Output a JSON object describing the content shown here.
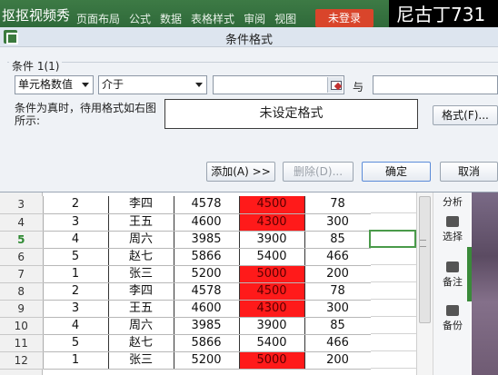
{
  "topbar": {
    "watermark_left": "抠抠视频秀",
    "ribbon_tabs": [
      "页面布局",
      "公式",
      "数据",
      "表格样式",
      "审阅",
      "视图"
    ],
    "login_label": "未登录",
    "watermark_right": "尼古丁731"
  },
  "dialog": {
    "title": "条件格式",
    "group_label": "条件 1(1)",
    "condition_type": "单元格数值",
    "operator": "介于",
    "value1": "",
    "and_label": "与",
    "value2": "",
    "hint": "条件为真时，待用格式如右图所示:",
    "preview_text": "未设定格式",
    "format_button": "格式(F)...",
    "add_button": "添加(A) >>",
    "delete_button": "删除(D)...",
    "ok_button": "确定",
    "cancel_button": "取消"
  },
  "sheet": {
    "active_row": "5",
    "rows": [
      {
        "row": "3",
        "a": "2",
        "b": "李四",
        "c": "4578",
        "d": "4500",
        "e": "78",
        "highlight": true
      },
      {
        "row": "4",
        "a": "3",
        "b": "王五",
        "c": "4600",
        "d": "4300",
        "e": "300",
        "highlight": true
      },
      {
        "row": "5",
        "a": "4",
        "b": "周六",
        "c": "3985",
        "d": "3900",
        "e": "85",
        "highlight": false
      },
      {
        "row": "6",
        "a": "5",
        "b": "赵七",
        "c": "5866",
        "d": "5400",
        "e": "466",
        "highlight": false
      },
      {
        "row": "7",
        "a": "1",
        "b": "张三",
        "c": "5200",
        "d": "5000",
        "e": "200",
        "highlight": true
      },
      {
        "row": "8",
        "a": "2",
        "b": "李四",
        "c": "4578",
        "d": "4500",
        "e": "78",
        "highlight": true
      },
      {
        "row": "9",
        "a": "3",
        "b": "王五",
        "c": "4600",
        "d": "4300",
        "e": "300",
        "highlight": true
      },
      {
        "row": "10",
        "a": "4",
        "b": "周六",
        "c": "3985",
        "d": "3900",
        "e": "85",
        "highlight": false
      },
      {
        "row": "11",
        "a": "5",
        "b": "赵七",
        "c": "5866",
        "d": "5400",
        "e": "466",
        "highlight": false
      },
      {
        "row": "12",
        "a": "1",
        "b": "张三",
        "c": "5200",
        "d": "5000",
        "e": "200",
        "highlight": true
      }
    ]
  },
  "sidepanel": {
    "items": [
      "分析",
      "选择",
      "备注",
      "备份"
    ]
  },
  "colors": {
    "highlight_fill": "#ff1a1a",
    "accent_green": "#3b7a3e",
    "login_red": "#d9452b"
  }
}
